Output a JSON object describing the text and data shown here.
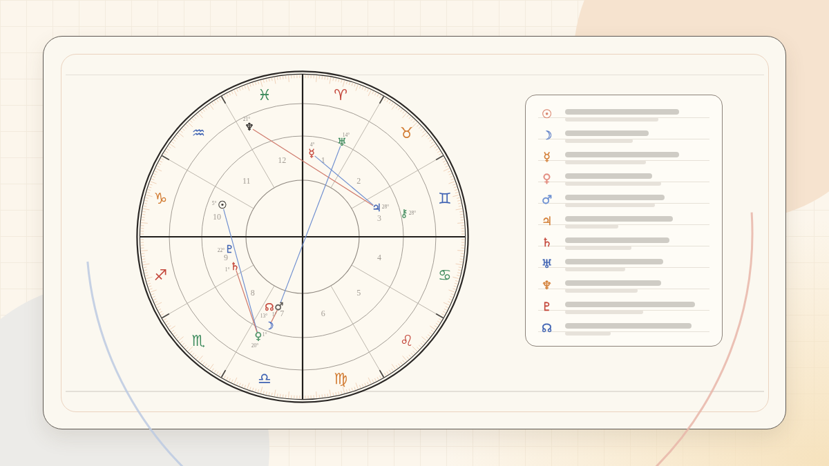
{
  "zodiac_signs": [
    {
      "symbol": "♈",
      "color": "#c4473b"
    },
    {
      "symbol": "♉",
      "color": "#d27c33"
    },
    {
      "symbol": "♊",
      "color": "#3f63b3"
    },
    {
      "symbol": "♋",
      "color": "#3f8c5e"
    },
    {
      "symbol": "♌",
      "color": "#c4473b"
    },
    {
      "symbol": "♍",
      "color": "#d27c33"
    },
    {
      "symbol": "♎",
      "color": "#3f63b3"
    },
    {
      "symbol": "♏",
      "color": "#3f8c5e"
    },
    {
      "symbol": "♐",
      "color": "#c4473b"
    },
    {
      "symbol": "♑",
      "color": "#d27c33"
    },
    {
      "symbol": "♒",
      "color": "#3f63b3"
    },
    {
      "symbol": "♓",
      "color": "#3f8c5e"
    }
  ],
  "house_numbers": [
    "1",
    "2",
    "3",
    "4",
    "5",
    "6",
    "7",
    "8",
    "9",
    "10",
    "11",
    "12"
  ],
  "planets": [
    {
      "symbol": "☉",
      "degree": "5°",
      "color": "#3a3734"
    },
    {
      "symbol": "☽",
      "degree": "1°",
      "color": "#4a6cc0"
    },
    {
      "symbol": "☿",
      "degree": "4°",
      "color": "#c4473b"
    },
    {
      "symbol": "♀",
      "degree": "20°",
      "color": "#4f9468"
    },
    {
      "symbol": "♂",
      "degree": "1°",
      "color": "#5a5652"
    },
    {
      "symbol": "♃",
      "degree": "28°",
      "color": "#3f63b3"
    },
    {
      "symbol": "♄",
      "degree": "1°",
      "color": "#c4473b"
    },
    {
      "symbol": "♅",
      "degree": "14°",
      "color": "#3f8c5e"
    },
    {
      "symbol": "♆",
      "degree": "21°",
      "color": "#2a2725"
    },
    {
      "symbol": "♇",
      "degree": "22°",
      "color": "#3f63b3"
    },
    {
      "symbol": "☊",
      "degree": "13°",
      "color": "#c4473b"
    },
    {
      "symbol": "⚷",
      "degree": "28°",
      "color": "#4f9468"
    }
  ],
  "aspect_lines": [
    {
      "color": "#cf7a6c"
    },
    {
      "color": "#6f8fd0"
    },
    {
      "color": "#6f8fd0"
    },
    {
      "color": "#6f8fd0"
    },
    {
      "color": "#cf7a6c"
    },
    {
      "color": "#cf7a6c"
    }
  ],
  "legend": [
    {
      "symbol": "☉",
      "color": "#d9836d"
    },
    {
      "symbol": "☽",
      "color": "#5a7cc6"
    },
    {
      "symbol": "☿",
      "color": "#d27c33"
    },
    {
      "symbol": "♀",
      "color": "#e38d80"
    },
    {
      "symbol": "♂",
      "color": "#6d90d2"
    },
    {
      "symbol": "♃",
      "color": "#d27c33"
    },
    {
      "symbol": "♄",
      "color": "#c4473b"
    },
    {
      "symbol": "♅",
      "color": "#3f63b3"
    },
    {
      "symbol": "♆",
      "color": "#d27c33"
    },
    {
      "symbol": "♇",
      "color": "#c4473b"
    },
    {
      "symbol": "☊",
      "color": "#3f63b3"
    }
  ]
}
